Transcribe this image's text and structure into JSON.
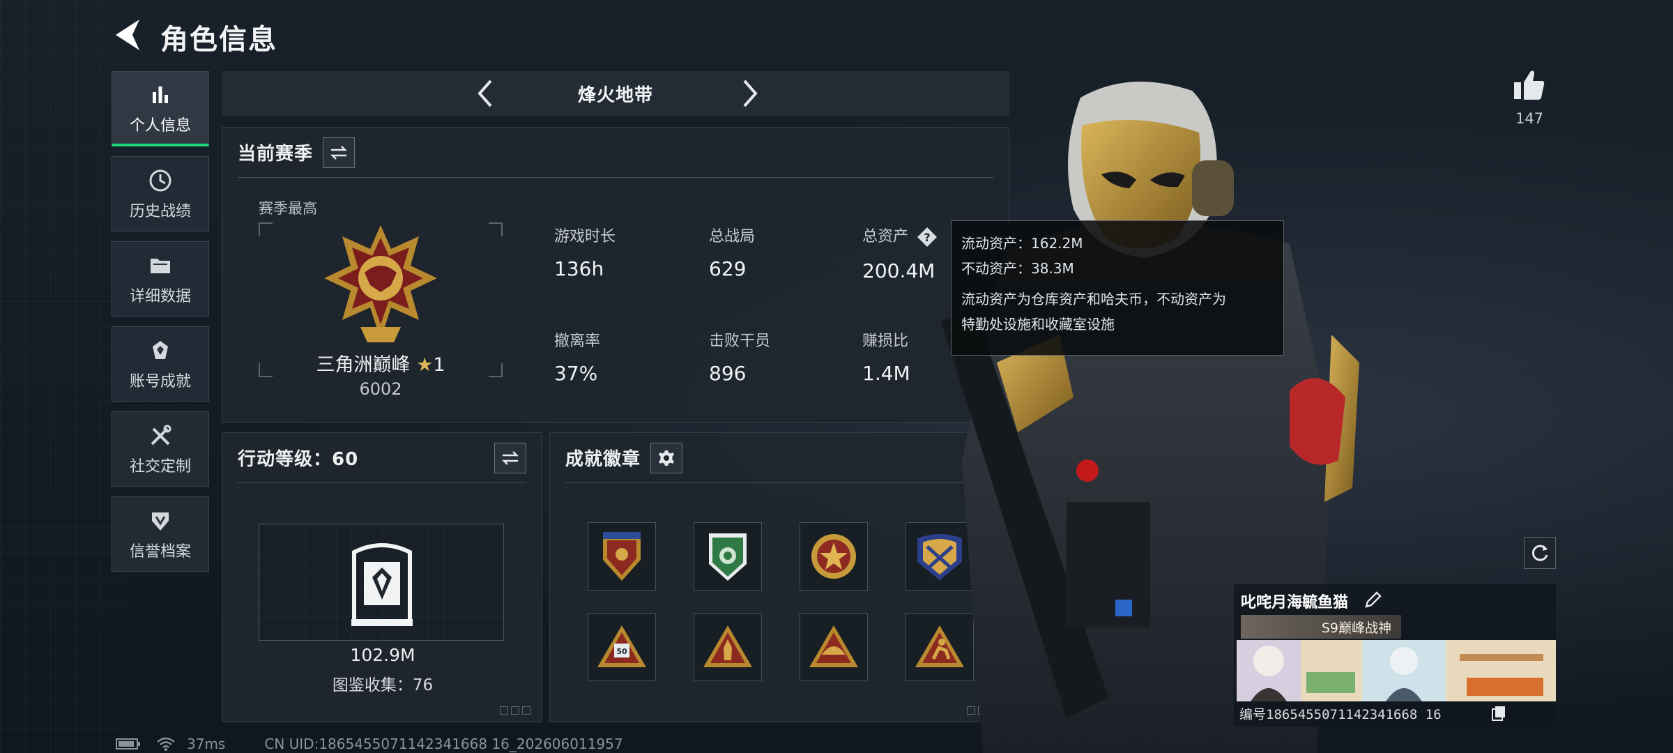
{
  "header": {
    "title": "角色信息"
  },
  "nav": {
    "items": [
      {
        "label": "个人信息",
        "icon": "bar-chart-icon",
        "active": true
      },
      {
        "label": "历史战绩",
        "icon": "clock-icon",
        "active": false
      },
      {
        "label": "详细数据",
        "icon": "folder-icon",
        "active": false
      },
      {
        "label": "账号成就",
        "icon": "trophy-icon",
        "active": false
      },
      {
        "label": "社交定制",
        "icon": "tools-icon",
        "active": false
      },
      {
        "label": "信誉档案",
        "icon": "shield-icon",
        "active": false
      }
    ]
  },
  "mode": {
    "title": "烽火地带"
  },
  "season": {
    "title": "当前赛季",
    "best_label": "赛季最高",
    "rank_name": "三角洲巅峰",
    "rank_stars": "1",
    "rank_score": "6002",
    "stats": [
      {
        "label": "游戏时长",
        "value": "136h"
      },
      {
        "label": "总战局",
        "value": "629"
      },
      {
        "label": "总资产",
        "value": "200.4M"
      },
      {
        "label": "撤离率",
        "value": "37%"
      },
      {
        "label": "击败干员",
        "value": "896"
      },
      {
        "label": "赚损比",
        "value": "1.4M"
      }
    ]
  },
  "tooltip": {
    "liquid": "流动资产：162.2M",
    "fixed": "不动资产：38.3M",
    "desc_1": "流动资产为仓库资产和哈夫币，不动资产为",
    "desc_2": "特勤处设施和收藏室设施"
  },
  "action": {
    "title": "行动等级：60",
    "amount": "102.9M",
    "collection": "图鉴收集：76"
  },
  "achievements": {
    "title": "成就徽章",
    "badges": [
      {
        "icon": "badge-shield-red-icon"
      },
      {
        "icon": "badge-green-lion-icon"
      },
      {
        "icon": "badge-star-medal-icon"
      },
      {
        "icon": "badge-crossed-arrows-icon"
      },
      {
        "icon": "badge-triangle-number-icon",
        "number": "50"
      },
      {
        "icon": "badge-triangle-figure-icon"
      },
      {
        "icon": "badge-triangle-cap-icon"
      },
      {
        "icon": "badge-triangle-runner-icon"
      }
    ]
  },
  "social": {
    "likes": "147"
  },
  "card": {
    "name": "叱咤月海毓鱼猫",
    "title": "S9巅峰战神",
    "id": "编号1865455071142341668 16"
  },
  "status": {
    "ping": "37ms",
    "uid": "CN UID:1865455071142341668 16_202606011957"
  },
  "colors": {
    "accent_green": "#1bd67a",
    "gold": "#c9a13b",
    "panel_bg": "#1f262e"
  }
}
